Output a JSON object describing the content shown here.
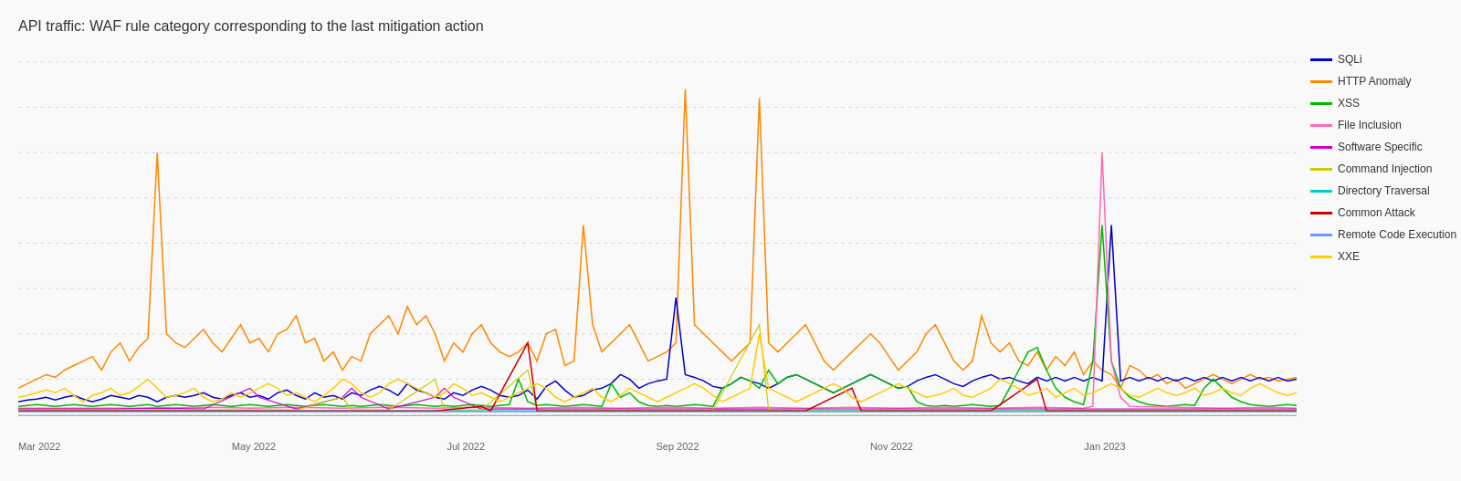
{
  "title": "API traffic: WAF rule category corresponding to the last mitigation action",
  "legend": {
    "items": [
      {
        "label": "SQLi",
        "color": "#0000cc",
        "id": "sqli"
      },
      {
        "label": "HTTP Anomaly",
        "color": "#ff8800",
        "id": "http-anomaly"
      },
      {
        "label": "XSS",
        "color": "#00bb00",
        "id": "xss"
      },
      {
        "label": "File Inclusion",
        "color": "#ff69b4",
        "id": "file-inclusion"
      },
      {
        "label": "Software Specific",
        "color": "#cc00cc",
        "id": "software-specific"
      },
      {
        "label": "Command Injection",
        "color": "#cccc00",
        "id": "command-injection"
      },
      {
        "label": "Directory Traversal",
        "color": "#00cccc",
        "id": "directory-traversal"
      },
      {
        "label": "Common Attack",
        "color": "#cc0000",
        "id": "common-attack"
      },
      {
        "label": "Remote Code Execution",
        "color": "#6699ff",
        "id": "rce"
      },
      {
        "label": "XXE",
        "color": "#ffcc00",
        "id": "xxe"
      }
    ]
  },
  "xaxis": {
    "labels": [
      "Mar 2022",
      "May 2022",
      "Jul 2022",
      "Sep 2022",
      "Nov 2022",
      "Jan 2023",
      ""
    ]
  }
}
